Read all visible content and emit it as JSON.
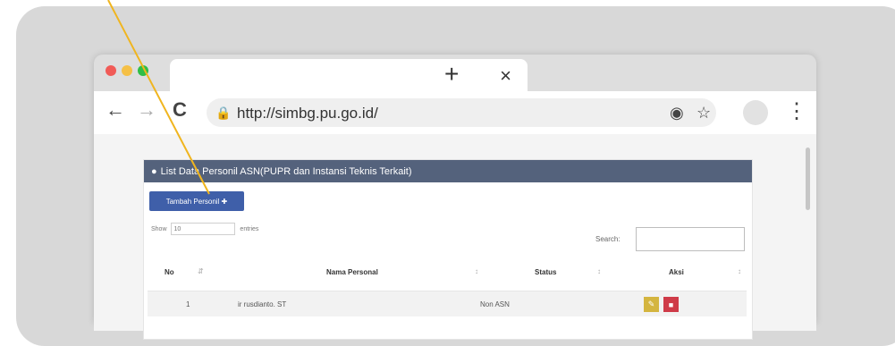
{
  "browser": {
    "address_url": "http://simbg.pu.go.id/",
    "tab_close": "×",
    "new_tab": "+",
    "nav_back": "←",
    "nav_forward": "→",
    "reload": "C",
    "lock": "🔒",
    "location_icon": "◉",
    "bookmark_icon": "☆",
    "menu": "⋮",
    "colors": {
      "red": "#f15b57",
      "yellow": "#f5c046",
      "green": "#2fbe47"
    }
  },
  "page": {
    "panel_title": "List Data Personil ASN(PUPR dan Instansi Teknis Terkait)",
    "add_button": "Tambah Personil",
    "show": "Show",
    "entries_value": "10",
    "entries": "entries",
    "search": "Search:",
    "columns": [
      "No",
      "Nama Personal",
      "Status",
      "Aksi"
    ],
    "rows": [
      {
        "no": "1",
        "name": "ir rusdianto. ST",
        "status": "Non ASN"
      }
    ]
  }
}
